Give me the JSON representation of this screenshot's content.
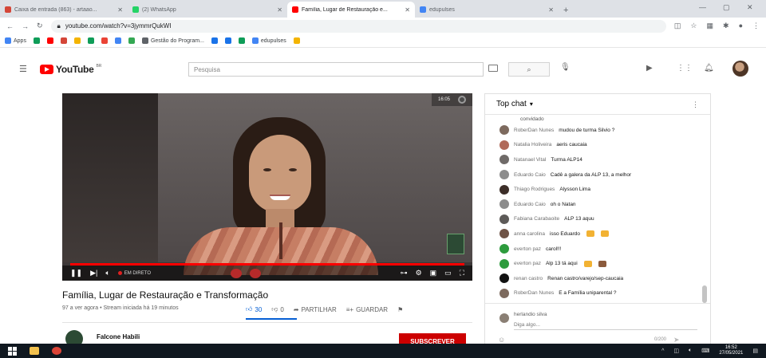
{
  "browser": {
    "tabs": [
      {
        "label": "Caixa de entrada (863) - artaao...",
        "favicon_color": "#d44638",
        "active": false
      },
      {
        "label": "(2) WhatsApp",
        "favicon_color": "#25d366",
        "active": false
      },
      {
        "label": "Família, Lugar de Restauração e...",
        "favicon_color": "#ff0000",
        "active": true
      },
      {
        "label": "edupulses",
        "favicon_color": "#4285f4",
        "active": false
      }
    ],
    "new_tab": "+",
    "url": "youtube.com/watch?v=3jymmrQukWI",
    "bookmarks": [
      {
        "label": "Apps",
        "color": "#4285f4"
      },
      {
        "label": "",
        "color": "#0f9d58"
      },
      {
        "label": "",
        "color": "#ff0000"
      },
      {
        "label": "",
        "color": "#d44638"
      },
      {
        "label": "",
        "color": "#f4b400"
      },
      {
        "label": "",
        "color": "#0f9d58"
      },
      {
        "label": "",
        "color": "#ea4335"
      },
      {
        "label": "",
        "color": "#4285f4"
      },
      {
        "label": "",
        "color": "#34a853"
      },
      {
        "label": "Gestão do Program...",
        "color": "#5f6368"
      },
      {
        "label": "",
        "color": "#1a73e8"
      },
      {
        "label": "",
        "color": "#1a73e8"
      },
      {
        "label": "",
        "color": "#0f9d58"
      },
      {
        "label": "edupulses",
        "color": "#4285f4"
      },
      {
        "label": "",
        "color": "#f4b400"
      }
    ]
  },
  "youtube": {
    "logo_text": "YouTube",
    "country": "BR",
    "search_placeholder": "Pesquisa"
  },
  "video": {
    "title": "Família, Lugar de Restauração e Transformação",
    "stats": "97 a ver agora • Stream iniciada há 19 minutos",
    "likes": "30",
    "dislikes": "0",
    "share_label": "PARTILHAR",
    "save_label": "GUARDAR",
    "live_label": "EM DIRETO",
    "channel_name": "Falcone Habili",
    "subscribe_label": "SUBSCREVER",
    "player_time": "16:05"
  },
  "chat": {
    "header": "Top chat",
    "previous_line": "convidado",
    "messages": [
      {
        "author": "RoberDan Nunes",
        "text": "mudou de turma Silvio ?",
        "avatar_color": "#7d6a5e",
        "emoji": []
      },
      {
        "author": "Natalia Holiveira",
        "text": "aeris caucaia",
        "avatar_color": "#b06a5a",
        "emoji": []
      },
      {
        "author": "Natanael Vital",
        "text": "Turma ALP14",
        "avatar_color": "#6f6a68",
        "emoji": []
      },
      {
        "author": "Eduardo Caio",
        "text": "Cadê a galera da ALP 13, a melhor",
        "avatar_color": "#8c8c8c",
        "emoji": []
      },
      {
        "author": "Thiago Rodrigues",
        "text": "Alysson Lima",
        "avatar_color": "#3c2e28",
        "emoji": []
      },
      {
        "author": "Eduardo Caio",
        "text": "oh o Natan",
        "avatar_color": "#8c8c8c",
        "emoji": []
      },
      {
        "author": "Fabiana Carabaoite",
        "text": "ALP 13 aquu",
        "avatar_color": "#5d5a58",
        "emoji": []
      },
      {
        "author": "anna carolina",
        "text": "isso Eduardo",
        "avatar_color": "#6e5346",
        "emoji": [
          "#f2b233",
          "#f2b233"
        ]
      },
      {
        "author": "everton paz",
        "text": "carol!!!",
        "avatar_color": "#2d9b3d",
        "emoji": []
      },
      {
        "author": "everton paz",
        "text": "Alp 13 tá aqui",
        "avatar_color": "#2d9b3d",
        "emoji": [
          "#f2b233",
          "#8b5a3c"
        ]
      },
      {
        "author": "renan castro",
        "text": "Renan castro/varejo/sep-caucaia",
        "avatar_color": "#111111",
        "emoji": []
      },
      {
        "author": "RoberDan Nunes",
        "text": "E a Família uniparental ?",
        "avatar_color": "#7d6a5e",
        "emoji": []
      }
    ],
    "input_user": "herlandio silva",
    "input_placeholder": "Diga algo...",
    "char_count": "0/200"
  },
  "taskbar": {
    "time": "16:52",
    "date": "27/05/2021"
  }
}
